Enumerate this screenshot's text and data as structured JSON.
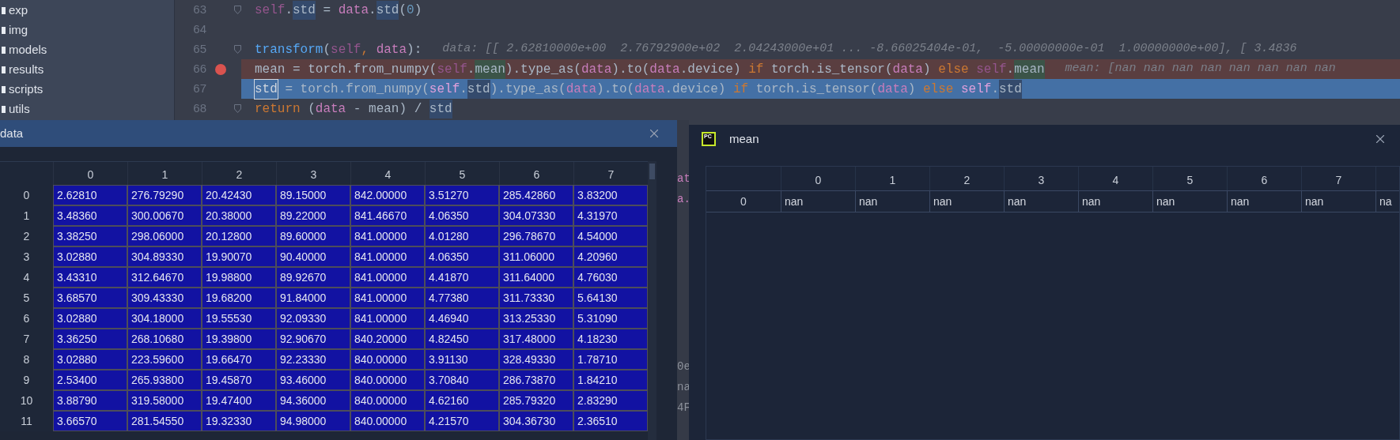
{
  "project_tree": {
    "items": [
      {
        "label": "exp"
      },
      {
        "label": "img"
      },
      {
        "label": "models"
      },
      {
        "label": "results"
      },
      {
        "label": "scripts"
      },
      {
        "label": "utils"
      }
    ]
  },
  "editor": {
    "lines": [
      {
        "number": "63",
        "kind": "normal",
        "fold": true,
        "tokens": [
          {
            "text": "self",
            "kind": "self"
          },
          {
            "text": ".",
            "kind": "plain"
          },
          {
            "text": "std",
            "kind": "usage"
          },
          {
            "text": " = ",
            "kind": "plain"
          },
          {
            "text": "data",
            "kind": "param"
          },
          {
            "text": ".",
            "kind": "plain"
          },
          {
            "text": "std",
            "kind": "usage"
          },
          {
            "text": "(",
            "kind": "plain"
          },
          {
            "text": "0",
            "kind": "number"
          },
          {
            "text": ")",
            "kind": "plain"
          }
        ]
      },
      {
        "number": "64",
        "kind": "normal",
        "fold": false
      },
      {
        "number": "65",
        "kind": "normal",
        "fold": true,
        "tokens": [
          {
            "text": "transform",
            "kind": "func"
          },
          {
            "text": "(",
            "kind": "plain"
          },
          {
            "text": "self",
            "kind": "self"
          },
          {
            "text": ", ",
            "kind": "keyword"
          },
          {
            "text": "data",
            "kind": "param"
          },
          {
            "text": "):",
            "kind": "plain"
          }
        ],
        "hint": "data: [[ 2.62810000e+00  2.76792900e+02  2.04243000e+01 ... -8.66025404e-01,  -5.00000000e-01  1.00000000e+00], [ 3.4836"
      },
      {
        "number": "66",
        "kind": "breakpoint",
        "fold": false,
        "tokens": [
          {
            "text": "mean = torch.from_numpy(",
            "kind": "plain"
          },
          {
            "text": "self",
            "kind": "self"
          },
          {
            "text": ".",
            "kind": "plain"
          },
          {
            "text": "mean",
            "kind": "match"
          },
          {
            "text": ").type_as(",
            "kind": "plain"
          },
          {
            "text": "data",
            "kind": "param"
          },
          {
            "text": ").to(",
            "kind": "plain"
          },
          {
            "text": "data",
            "kind": "param"
          },
          {
            "text": ".device) ",
            "kind": "plain"
          },
          {
            "text": "if",
            "kind": "keyword"
          },
          {
            "text": " torch.is_tensor(",
            "kind": "plain"
          },
          {
            "text": "data",
            "kind": "param"
          },
          {
            "text": ") ",
            "kind": "plain"
          },
          {
            "text": "else ",
            "kind": "keyword"
          },
          {
            "text": "self",
            "kind": "self"
          },
          {
            "text": ".",
            "kind": "plain"
          },
          {
            "text": "mean",
            "kind": "match"
          }
        ],
        "hint": "mean: [nan nan nan nan nan nan nan nan"
      },
      {
        "number": "67",
        "kind": "selected",
        "fold": false,
        "tokens": [
          {
            "text": "std",
            "kind": "boxed"
          },
          {
            "text": " = torch.from_numpy(",
            "kind": "plain"
          },
          {
            "text": "self",
            "kind": "self"
          },
          {
            "text": ".",
            "kind": "plain"
          },
          {
            "text": "std",
            "kind": "usage"
          },
          {
            "text": ").type_as(",
            "kind": "plain"
          },
          {
            "text": "data",
            "kind": "param"
          },
          {
            "text": ").to(",
            "kind": "plain"
          },
          {
            "text": "data",
            "kind": "param"
          },
          {
            "text": ".device) ",
            "kind": "plain"
          },
          {
            "text": "if",
            "kind": "keyword"
          },
          {
            "text": " torch.is_tensor(",
            "kind": "plain"
          },
          {
            "text": "data",
            "kind": "param"
          },
          {
            "text": ") ",
            "kind": "plain"
          },
          {
            "text": "else ",
            "kind": "keyword"
          },
          {
            "text": "self",
            "kind": "self"
          },
          {
            "text": ".",
            "kind": "plain"
          },
          {
            "text": "std",
            "kind": "usage"
          }
        ]
      },
      {
        "number": "68",
        "kind": "normal",
        "fold": true,
        "tokens": [
          {
            "text": "return",
            "kind": "keyword"
          },
          {
            "text": " (",
            "kind": "plain"
          },
          {
            "text": "data",
            "kind": "param"
          },
          {
            "text": " - mean) / ",
            "kind": "plain"
          },
          {
            "text": "std",
            "kind": "usage"
          }
        ]
      }
    ]
  },
  "data_window": {
    "title": "data",
    "columns": [
      "0",
      "1",
      "2",
      "3",
      "4",
      "5",
      "6",
      "7"
    ],
    "rows": [
      {
        "index": "0",
        "cells": [
          "2.62810",
          "276.79290",
          "20.42430",
          "89.15000",
          "842.00000",
          "3.51270",
          "285.42860",
          "3.83200"
        ]
      },
      {
        "index": "1",
        "cells": [
          "3.48360",
          "300.00670",
          "20.38000",
          "89.22000",
          "841.46670",
          "4.06350",
          "304.07330",
          "4.31970"
        ]
      },
      {
        "index": "2",
        "cells": [
          "3.38250",
          "298.06000",
          "20.12800",
          "89.60000",
          "841.00000",
          "4.01280",
          "296.78670",
          "4.54000"
        ]
      },
      {
        "index": "3",
        "cells": [
          "3.02880",
          "304.89330",
          "19.90070",
          "90.40000",
          "841.00000",
          "4.06350",
          "311.06000",
          "4.20960"
        ]
      },
      {
        "index": "4",
        "cells": [
          "3.43310",
          "312.64670",
          "19.98800",
          "89.92670",
          "841.00000",
          "4.41870",
          "311.64000",
          "4.76030"
        ]
      },
      {
        "index": "5",
        "cells": [
          "3.68570",
          "309.43330",
          "19.68200",
          "91.84000",
          "841.00000",
          "4.77380",
          "311.73330",
          "5.64130"
        ]
      },
      {
        "index": "6",
        "cells": [
          "3.02880",
          "304.18000",
          "19.55530",
          "92.09330",
          "841.00000",
          "4.46940",
          "313.25330",
          "5.31090"
        ]
      },
      {
        "index": "7",
        "cells": [
          "3.36250",
          "268.10680",
          "19.39800",
          "92.90670",
          "840.20000",
          "4.82450",
          "317.48000",
          "4.18230"
        ]
      },
      {
        "index": "8",
        "cells": [
          "3.02880",
          "223.59600",
          "19.66470",
          "92.23330",
          "840.00000",
          "3.91130",
          "328.49330",
          "1.78710"
        ]
      },
      {
        "index": "9",
        "cells": [
          "2.53400",
          "265.93800",
          "19.45870",
          "93.46000",
          "840.00000",
          "3.70840",
          "286.73870",
          "1.84210"
        ]
      },
      {
        "index": "10",
        "cells": [
          "3.88790",
          "319.58000",
          "19.47400",
          "94.36000",
          "840.00000",
          "4.62160",
          "285.79320",
          "2.83290"
        ]
      },
      {
        "index": "11",
        "cells": [
          "3.66570",
          "281.54550",
          "19.32330",
          "94.98000",
          "840.00000",
          "4.21570",
          "304.36730",
          "2.36510"
        ]
      }
    ]
  },
  "background_fragments": [
    {
      "text": "at",
      "kind": "param"
    },
    {
      "text": "a.",
      "kind": "param"
    },
    {
      "text": "0e",
      "kind": "plain"
    },
    {
      "text": "na",
      "kind": "plain"
    },
    {
      "text": "4F",
      "kind": "plain"
    }
  ],
  "mean_window": {
    "title": "mean",
    "app_icon_label": "PC",
    "columns": [
      "0",
      "1",
      "2",
      "3",
      "4",
      "5",
      "6",
      "7"
    ],
    "rows": [
      {
        "index": "0",
        "cells": [
          "nan",
          "nan",
          "nan",
          "nan",
          "nan",
          "nan",
          "nan",
          "nan",
          "na"
        ]
      }
    ]
  }
}
